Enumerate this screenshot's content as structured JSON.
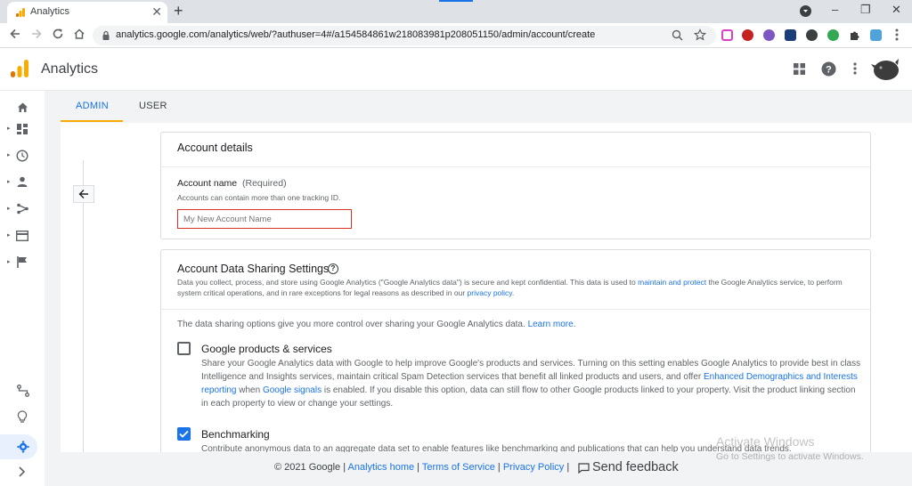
{
  "browser": {
    "tab_title": "Analytics",
    "tab_close": "✕",
    "new_tab": "+",
    "url": "analytics.google.com/analytics/web/?authuser=4#/a154584861w218083981p208051150/admin/account/create",
    "window_controls": [
      "–",
      "❐",
      "✕"
    ]
  },
  "app": {
    "title": "Analytics",
    "brand_colors": [
      "#f9ab00",
      "#e37400"
    ]
  },
  "admin_tabs": [
    "ADMIN",
    "USER"
  ],
  "account_details": {
    "heading": "Account details",
    "name_label": "Account name",
    "name_required": "(Required)",
    "name_help": "Accounts can contain more than one tracking ID.",
    "name_placeholder": "My New Account Name"
  },
  "sharing": {
    "heading": "Account Data Sharing Settings",
    "help_icon": "?",
    "desc_1": "Data you collect, process, and store using Google Analytics (\"Google Analytics data\") is secure and kept confidential. This data is used to ",
    "desc_link1": "maintain and protect",
    "desc_2": " the Google Analytics service, to perform system critical operations, and in rare exceptions for legal reasons as described in our ",
    "desc_link2": "privacy policy",
    "desc_3": ".",
    "intro": "The data sharing options give you more control over sharing your Google Analytics data. ",
    "intro_link": "Learn more.",
    "options": [
      {
        "label": "Google products & services",
        "checked": false,
        "text_1": "Share your Google Analytics data with Google to help improve Google's products and services. Turning on this setting enables Google Analytics to provide best in class Intelligence and Insights services, maintain critical Spam Detection services that benefit all linked products and users, and offer ",
        "link_1": "Enhanced Demographics and Interests reporting",
        "text_2": " when ",
        "link_2": "Google signals",
        "text_3": " is enabled. If you disable this option, data can still flow to other Google products linked to your property. Visit the product linking section in each property to view or change your settings."
      },
      {
        "label": "Benchmarking",
        "checked": true,
        "text_1": "Contribute anonymous data to an aggregate data set to enable features like benchmarking and publications that can help you understand data trends."
      }
    ]
  },
  "footer": {
    "copyright": "© 2021 Google | ",
    "home": "Analytics home",
    "sep": " | ",
    "terms": "Terms of Service",
    "privacy": "Privacy Policy",
    "sep2": " | ",
    "feedback": "Send feedback"
  },
  "watermark": {
    "line1": "Activate Windows",
    "line2": "Go to Settings to activate Windows."
  }
}
